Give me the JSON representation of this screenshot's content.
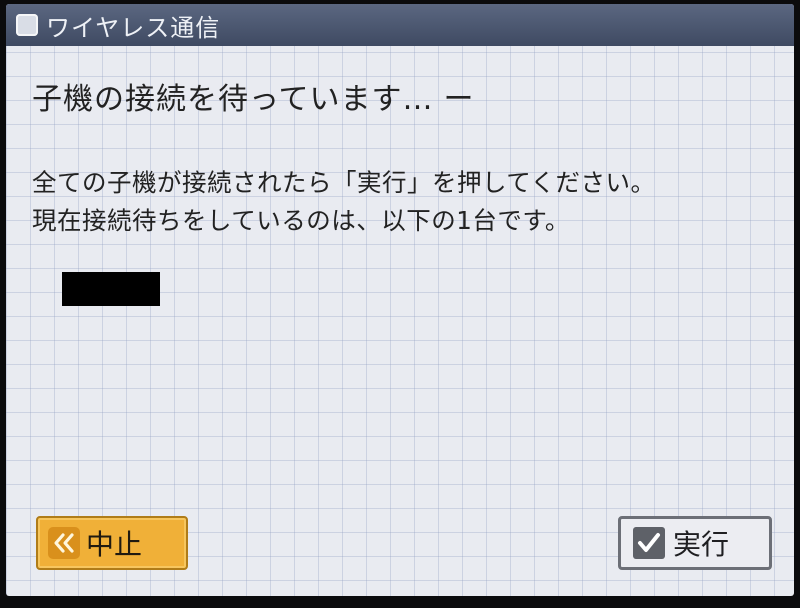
{
  "header": {
    "title": "ワイヤレス通信"
  },
  "heading": {
    "text": "子機の接続を待っています…",
    "spinner": "ー"
  },
  "message": {
    "line1": "全ての子機が接続されたら「実行」を押してください。",
    "line2": "現在接続待ちをしているのは、以下の1台です。"
  },
  "devices": [
    {
      "name": "",
      "redacted": true
    }
  ],
  "buttons": {
    "cancel_label": "中止",
    "cancel_icon": "double-chevron-left-icon",
    "execute_label": "実行",
    "execute_icon": "checkmark-icon"
  },
  "colors": {
    "titlebar": "#4d5872",
    "cancel_button": "#f0b038",
    "execute_button_border": "#6c6f77",
    "background_grid": "#e9ebf1"
  }
}
